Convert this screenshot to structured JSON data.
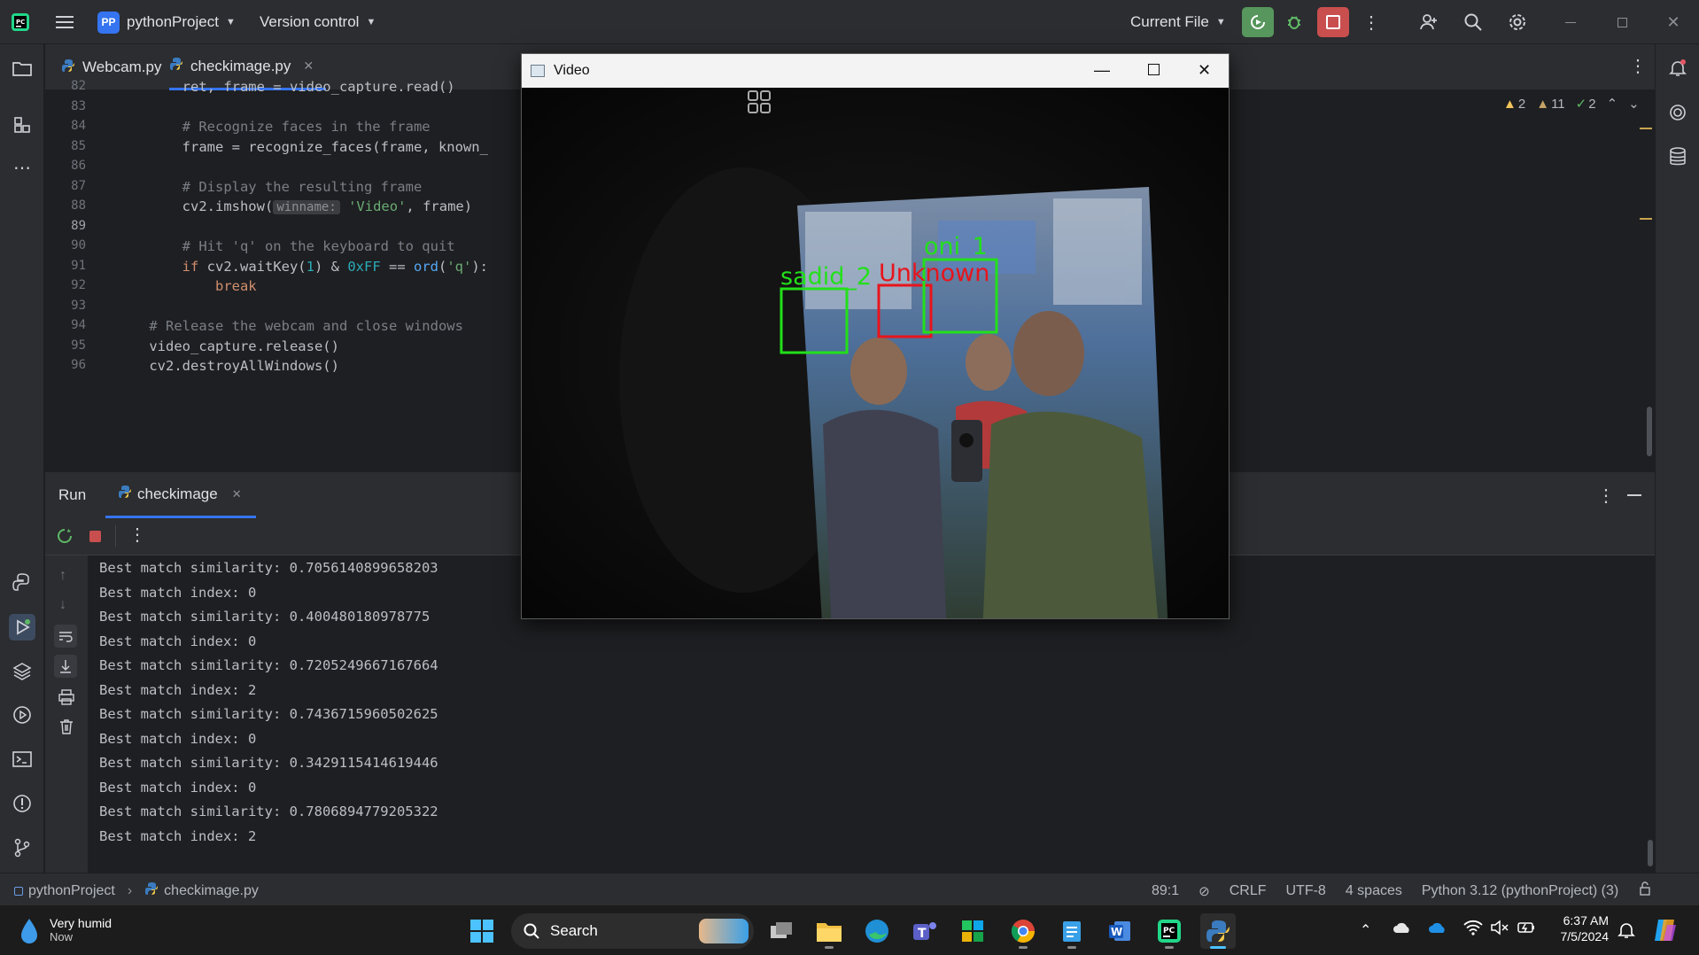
{
  "titlebar": {
    "project_badge": "PP",
    "project_name": "pythonProject",
    "version_control": "Version control",
    "run_config": "Current File"
  },
  "editor": {
    "tabs": [
      {
        "label": "Webcam.py",
        "active": false
      },
      {
        "label": "checkimage.py",
        "active": true
      }
    ],
    "inspections": {
      "warnings_a": "2",
      "warnings_b": "11",
      "ok": "2"
    },
    "lines": [
      {
        "n": "82",
        "code": "        ret, frame = video_capture.read()"
      },
      {
        "n": "83",
        "code": ""
      },
      {
        "n": "84",
        "code": "        # Recognize faces in the frame"
      },
      {
        "n": "85",
        "code": "        frame = recognize_faces(frame, known_"
      },
      {
        "n": "86",
        "code": ""
      },
      {
        "n": "87",
        "code": "        # Display the resulting frame"
      },
      {
        "n": "88",
        "code": "        cv2.imshow(",
        "hint": "winname:",
        "code_after": " 'Video', frame)"
      },
      {
        "n": "89",
        "code": ""
      },
      {
        "n": "90",
        "code": "        # Hit 'q' on the keyboard to quit"
      },
      {
        "n": "91",
        "code": "        if cv2.waitKey(1) & 0xFF == ord('q'):"
      },
      {
        "n": "92",
        "code": "            break"
      },
      {
        "n": "93",
        "code": ""
      },
      {
        "n": "94",
        "code": "    # Release the webcam and close windows"
      },
      {
        "n": "95",
        "code": "    video_capture.release()"
      },
      {
        "n": "96",
        "code": "    cv2.destroyAllWindows()"
      }
    ]
  },
  "run": {
    "title": "Run",
    "tab": "checkimage",
    "console": [
      "Best match similarity: 0.7056140899658203",
      "Best match index: 0",
      "Best match similarity: 0.400480180978775",
      "Best match index: 0",
      "Best match similarity: 0.7205249667167664",
      "Best match index: 2",
      "Best match similarity: 0.7436715960502625",
      "Best match index: 0",
      "Best match similarity: 0.3429115414619446",
      "Best match index: 0",
      "Best match similarity: 0.7806894779205322",
      "Best match index: 2"
    ]
  },
  "statusbar": {
    "breadcrumb_project": "pythonProject",
    "breadcrumb_file": "checkimage.py",
    "position": "89:1",
    "line_sep": "CRLF",
    "encoding": "UTF-8",
    "indent": "4 spaces",
    "interpreter": "Python 3.12 (pythonProject) (3)"
  },
  "video": {
    "title": "Video",
    "labels": [
      {
        "name": "sadid_2",
        "color": "#22e01a"
      },
      {
        "name": "Unknown",
        "color": "#e8141b"
      },
      {
        "name": "oni_1",
        "color": "#22e01a"
      }
    ]
  },
  "taskbar": {
    "weather_title": "Very humid",
    "weather_sub": "Now",
    "search": "Search",
    "time": "6:37 AM",
    "date": "7/5/2024"
  },
  "colors": {
    "accent": "#3574f0",
    "match_box": "#22e01a",
    "unknown_box": "#e8141b"
  }
}
